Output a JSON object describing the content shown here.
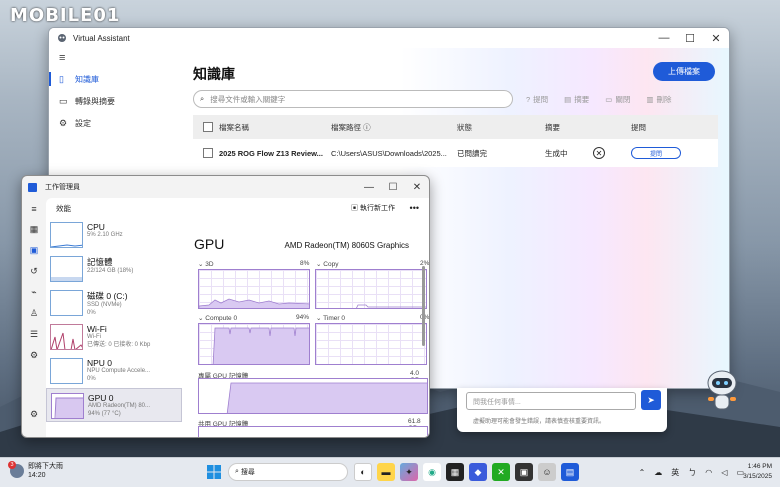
{
  "watermark": "MOBILE01",
  "virtual_assistant": {
    "window_title": "Virtual Assistant",
    "controls": {
      "minimize": "—",
      "maximize": "☐",
      "close": "✕"
    },
    "nav": [
      {
        "label": "知識庫",
        "icon": "book-icon"
      },
      {
        "label": "轉錄與摘要",
        "icon": "transcribe-icon"
      },
      {
        "label": "設定",
        "icon": "gear-icon"
      }
    ],
    "heading": "知識庫",
    "upload_label": "上傳檔案",
    "search_placeholder": "搜尋文件或輸入關鍵字",
    "tools": {
      "ask": "提問",
      "summary": "摘要",
      "close": "關閉",
      "delete": "刪除"
    },
    "table": {
      "headers": [
        "檔案名稱",
        "檔案路徑",
        "狀態",
        "摘要",
        "提問"
      ],
      "rows": [
        {
          "name": "2025 ROG Flow Z13 Review...",
          "path": "C:\\Users\\ASUS\\Downloads\\2025...",
          "status": "已問讀完",
          "summary": "生成中",
          "ask": "提問"
        }
      ]
    },
    "chat_placeholder": "問我任何事情...",
    "chat_disclaimer": "虛擬助理可能會發生錯誤，請表慎查核重要資訊。"
  },
  "task_manager": {
    "window_title": "工作管理員",
    "controls": {
      "minimize": "—",
      "maximize": "☐",
      "close": "✕"
    },
    "section": "效能",
    "new_task": "執行新工作",
    "more": "•••",
    "devices": [
      {
        "name": "CPU",
        "sub1": "5% 2.10 GHz",
        "sub2": ""
      },
      {
        "name": "記憶體",
        "sub1": "22/124 GB (18%)",
        "sub2": ""
      },
      {
        "name": "磁碟 0 (C:)",
        "sub1": "SSD (NVMe)",
        "sub2": "0%"
      },
      {
        "name": "Wi-Fi",
        "sub1": "Wi-Fi",
        "sub2": "已傳送: 0 已接收: 0 Kbp"
      },
      {
        "name": "NPU 0",
        "sub1": "NPU Compute Accele...",
        "sub2": "0%"
      },
      {
        "name": "GPU 0",
        "sub1": "AMD Radeon(TM) 80...",
        "sub2": "94% (77 °C)"
      }
    ],
    "gpu": {
      "title": "GPU",
      "model": "AMD Radeon(TM) 8060S Graphics",
      "engines": [
        {
          "name": "3D",
          "value": "8%"
        },
        {
          "name": "Copy",
          "value": "2%"
        },
        {
          "name": "Compute 0",
          "value": "94%"
        },
        {
          "name": "Timer 0",
          "value": "0%"
        }
      ],
      "dedicated_label": "專屬 GPU 記憶體",
      "dedicated_value": "4.0 GB",
      "shared_label": "共用 GPU 記憶體",
      "shared_value": "61.8 GB"
    }
  },
  "taskbar": {
    "weather_text": "即將下大雨",
    "weather_time": "14:20",
    "badge": "3",
    "search_placeholder": "搜尋",
    "ime": "英",
    "time": "1:46 PM",
    "date": "3/15/2025"
  }
}
